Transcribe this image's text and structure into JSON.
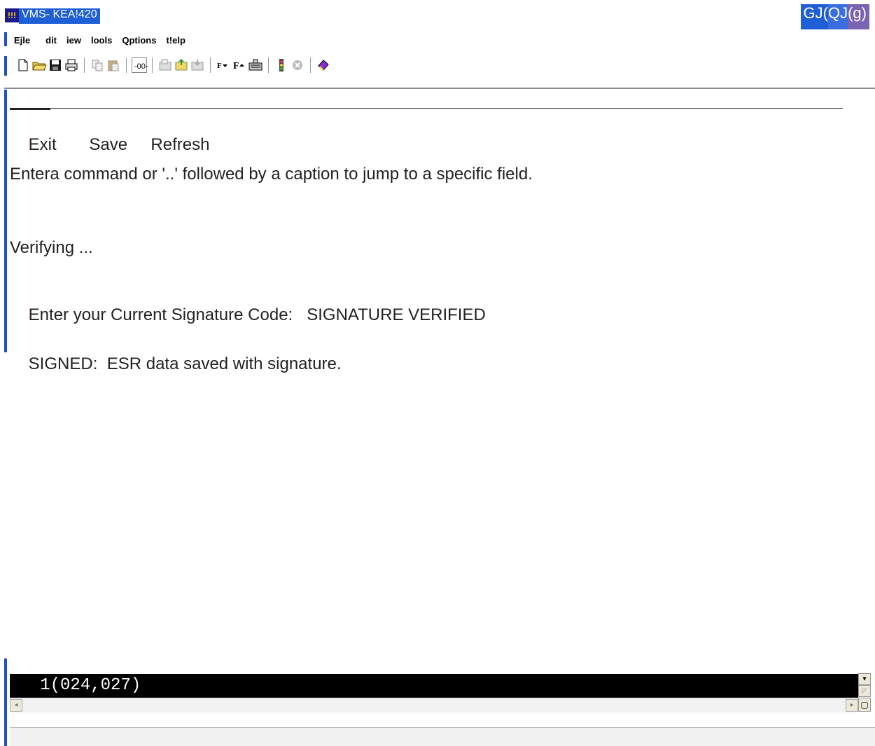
{
  "window": {
    "app_icon": "!!!",
    "title": "VMS- KEA!420",
    "controls": [
      "GJ(",
      "QJ",
      "(g)"
    ]
  },
  "menubar": {
    "items": [
      "Ejle",
      "dit",
      "iew",
      "lools",
      "Qptions",
      "t!elp"
    ]
  },
  "toolbar": {
    "icons": [
      "new-document-icon",
      "open-folder-icon",
      "save-disk-icon",
      "print-icon",
      "copy-icon",
      "paste-icon",
      "connect-icon",
      "open-session-icon",
      "upload-icon",
      "download-icon",
      "font-down-icon",
      "font-up-icon",
      "keyboard-icon",
      "traffic-light-icon",
      "stop-icon",
      "help-book-icon"
    ]
  },
  "terminal": {
    "menu": {
      "exit": "Exit",
      "save": "Save",
      "refresh": "Refresh"
    },
    "instruction": "Entera command or '..' followed by a caption to jump to a specific field.",
    "verifying": "Verifying ...",
    "signature_prompt": "Enter your Current Signature Code:",
    "signature_status": "SIGNATURE VERIFIED",
    "signed_label": "SIGNED:",
    "signed_message": "ESR data saved with signature."
  },
  "status": {
    "position": "1(024,027)"
  },
  "colors": {
    "accent": "#1f4fc8",
    "title_bg": "#1f5fd6",
    "status_bg": "#000000"
  }
}
